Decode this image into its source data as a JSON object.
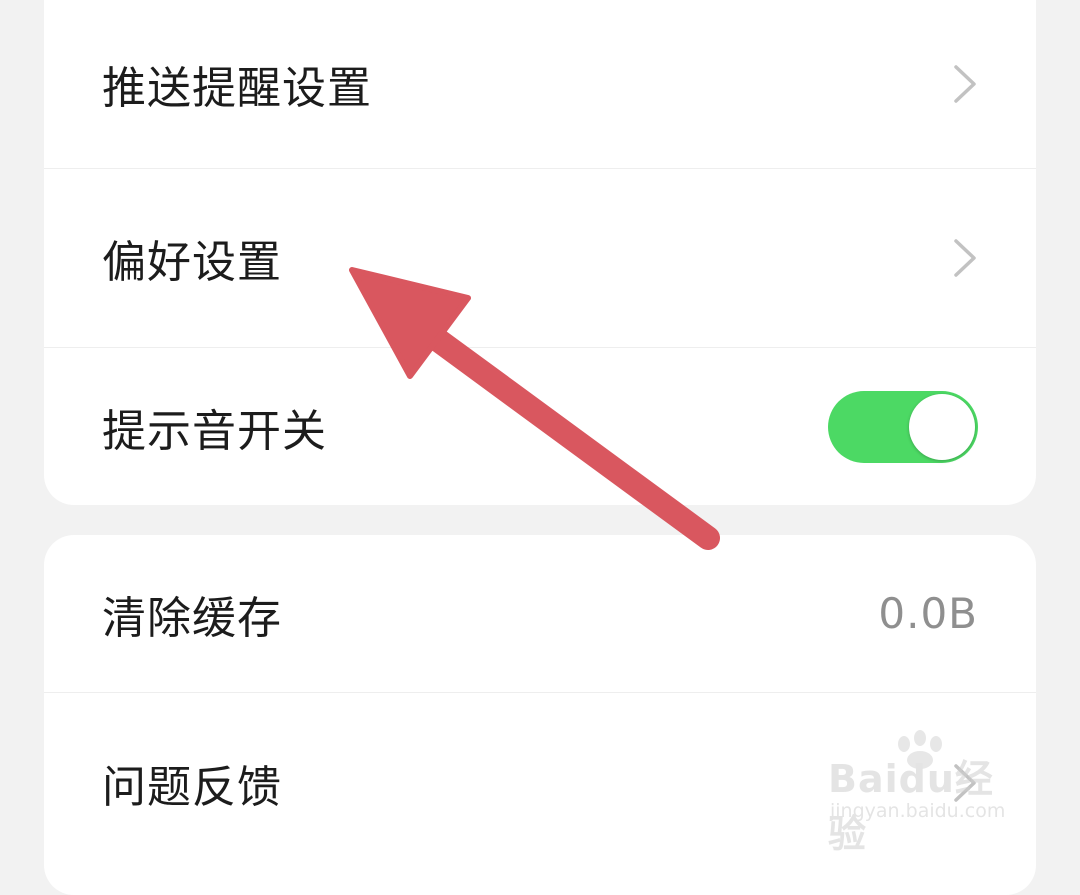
{
  "settings_group_1": {
    "items": [
      {
        "label": "推送提醒设置",
        "control": "chevron"
      },
      {
        "label": "偏好设置",
        "control": "chevron"
      },
      {
        "label": "提示音开关",
        "control": "toggle",
        "toggle_on": true
      }
    ]
  },
  "settings_group_2": {
    "items": [
      {
        "label": "清除缓存",
        "value": "0.0B"
      },
      {
        "label": "问题反馈",
        "control": "chevron"
      }
    ]
  },
  "colors": {
    "background": "#f2f2f2",
    "card": "#ffffff",
    "toggle_on": "#4cd964",
    "annotation_arrow": "#d9575f",
    "chevron": "#c2c2c2"
  },
  "annotation": {
    "icon": "red-arrow-annotation",
    "points_to": "偏好设置"
  },
  "watermark": {
    "brand": "Baidu经验",
    "url": "jingyan.baidu.com"
  }
}
